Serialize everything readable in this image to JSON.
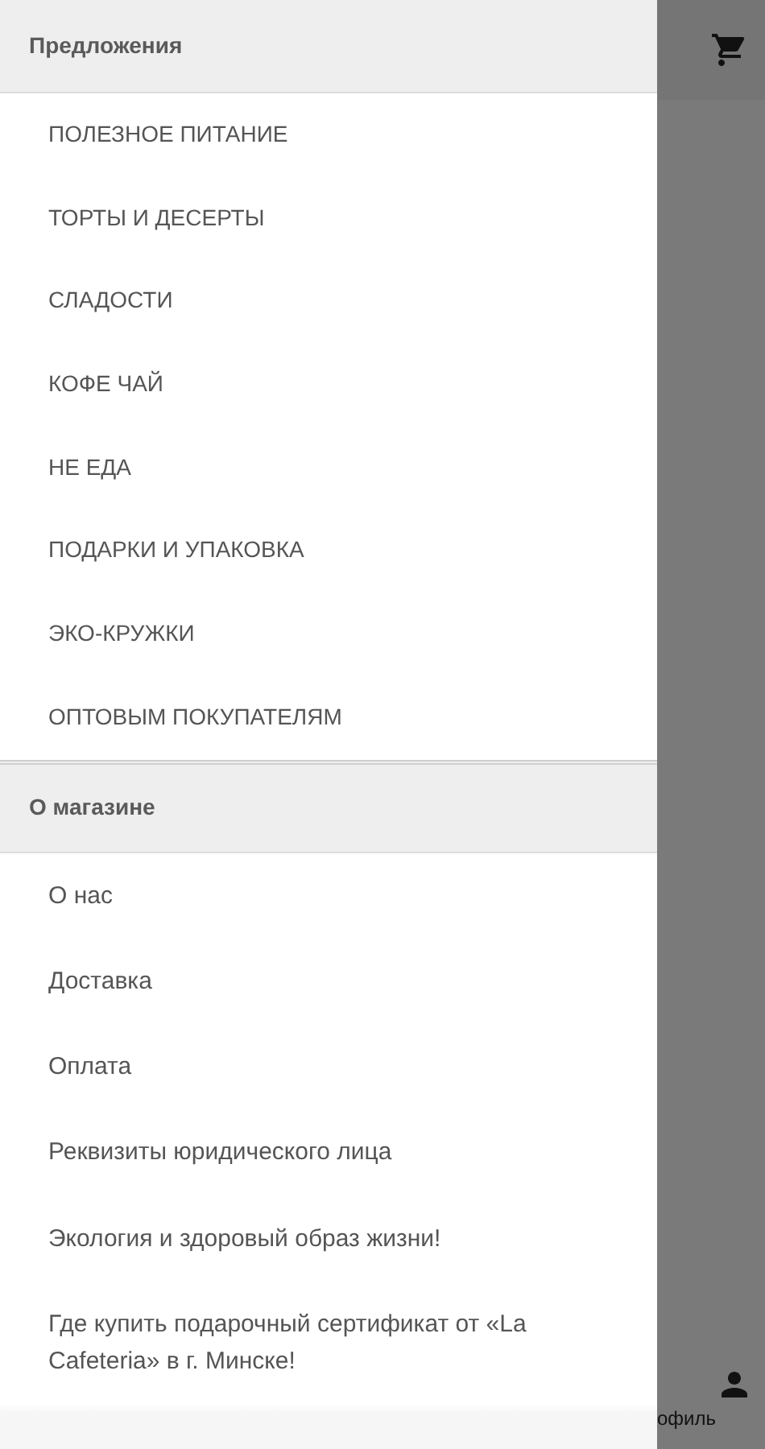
{
  "sections": [
    {
      "title": "Предложения",
      "items": [
        {
          "label": "ПОЛЕЗНОЕ ПИТАНИЕ"
        },
        {
          "label": "ТОРТЫ И ДЕСЕРТЫ"
        },
        {
          "label": "СЛАДОСТИ"
        },
        {
          "label": "КОФЕ ЧАЙ"
        },
        {
          "label": "НЕ ЕДА"
        },
        {
          "label": "ПОДАРКИ И УПАКОВКА"
        },
        {
          "label": "ЭКО-КРУЖКИ"
        },
        {
          "label": "ОПТОВЫМ ПОКУПАТЕЛЯМ"
        }
      ]
    },
    {
      "title": "О магазине",
      "items": [
        {
          "label": "О нас"
        },
        {
          "label": "Доставка"
        },
        {
          "label": "Оплата"
        },
        {
          "label": "Реквизиты юридического лица"
        },
        {
          "label": "Экология и здоровый образ жизни!"
        },
        {
          "label": "Где купить подарочный сертификат от «La Cafeteria» в г. Минске!"
        }
      ]
    }
  ],
  "bottom_tab": {
    "label": "офиль"
  }
}
